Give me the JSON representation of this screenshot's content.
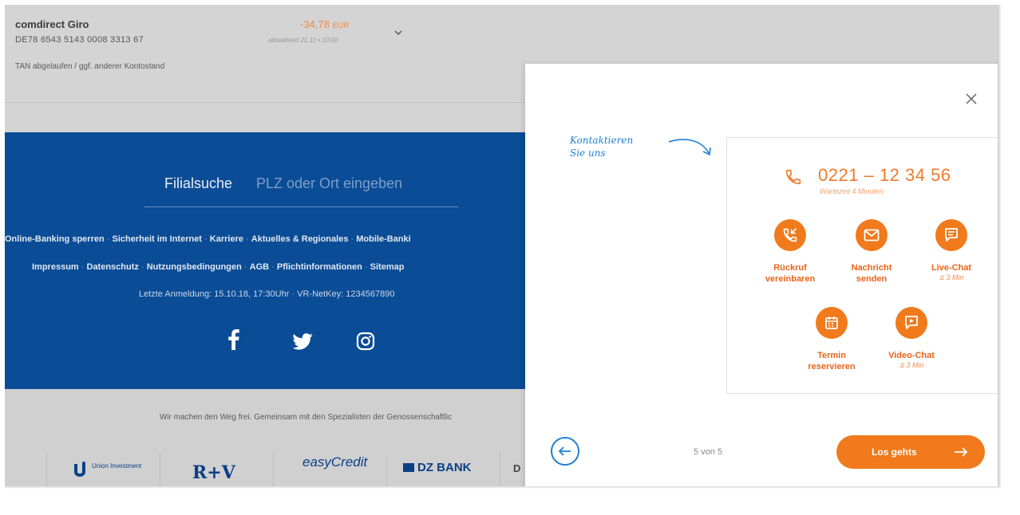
{
  "account": {
    "name": "comdirect Giro",
    "iban": "DE78 6543 5143 0008 3313 67",
    "amount": "-34,78",
    "currency": "EUR",
    "updated": "aktualisiert 21.11 • 10:00",
    "tan_status": "TAN abgelaufen / ggf. anderer Kontostand",
    "amount_color": "#f08a4b"
  },
  "footer": {
    "branch_search_label": "Filialsuche",
    "branch_search_placeholder": "PLZ oder Ort eingeben",
    "links_row1": [
      "Online-Banking sperren",
      "Sicherheit im Internet",
      "Karriere",
      "Aktuelles & Regionales",
      "Mobile-Banki"
    ],
    "links_row2": [
      "Impressum",
      "Datenschutz",
      "Nutzungsbedingungen",
      "AGB",
      "Pflichtinformationen",
      "Sitemap"
    ],
    "last_login": "Letzte Anmeldung: 15.10.18, 17:30Uhr",
    "vr_netkey": "VR-NetKey: 1234567890",
    "social": [
      "facebook-icon",
      "twitter-icon",
      "instagram-icon"
    ],
    "bg_color": "#0a4c96"
  },
  "lower": {
    "slogan": "Wir machen den Weg frei. Gemeinsam mit den Spezialisten der Genossenschaftlic",
    "partners": [
      "Union Investment",
      "R+V",
      "easyCredit",
      "DZ BANK",
      "D"
    ]
  },
  "modal": {
    "handwritten_note": [
      "Kontaktieren",
      "Sie uns"
    ],
    "phone": "0221 – 12 34 56",
    "wait_time": "Wartezeit 4 Minuten",
    "options": [
      {
        "id": "callback",
        "label": "Rückruf\nvereinbaren",
        "time": "",
        "icon": "phone-callback-icon"
      },
      {
        "id": "message",
        "label": "Nachricht\nsenden",
        "time": "",
        "icon": "envelope-icon"
      },
      {
        "id": "livechat",
        "label": "Live-Chat",
        "time": "⧖ 3 Min",
        "icon": "chat-bubble-icon"
      },
      {
        "id": "appointment",
        "label": "Termin\nreservieren",
        "time": "",
        "icon": "calendar-icon"
      },
      {
        "id": "videochat",
        "label": "Video-Chat",
        "time": "⧖ 3 Min",
        "icon": "video-play-icon"
      }
    ],
    "pager": "5 von 5",
    "cta_label": "Los gehts",
    "accent_color": "#f07a1c",
    "link_color": "#1f7fd4"
  }
}
